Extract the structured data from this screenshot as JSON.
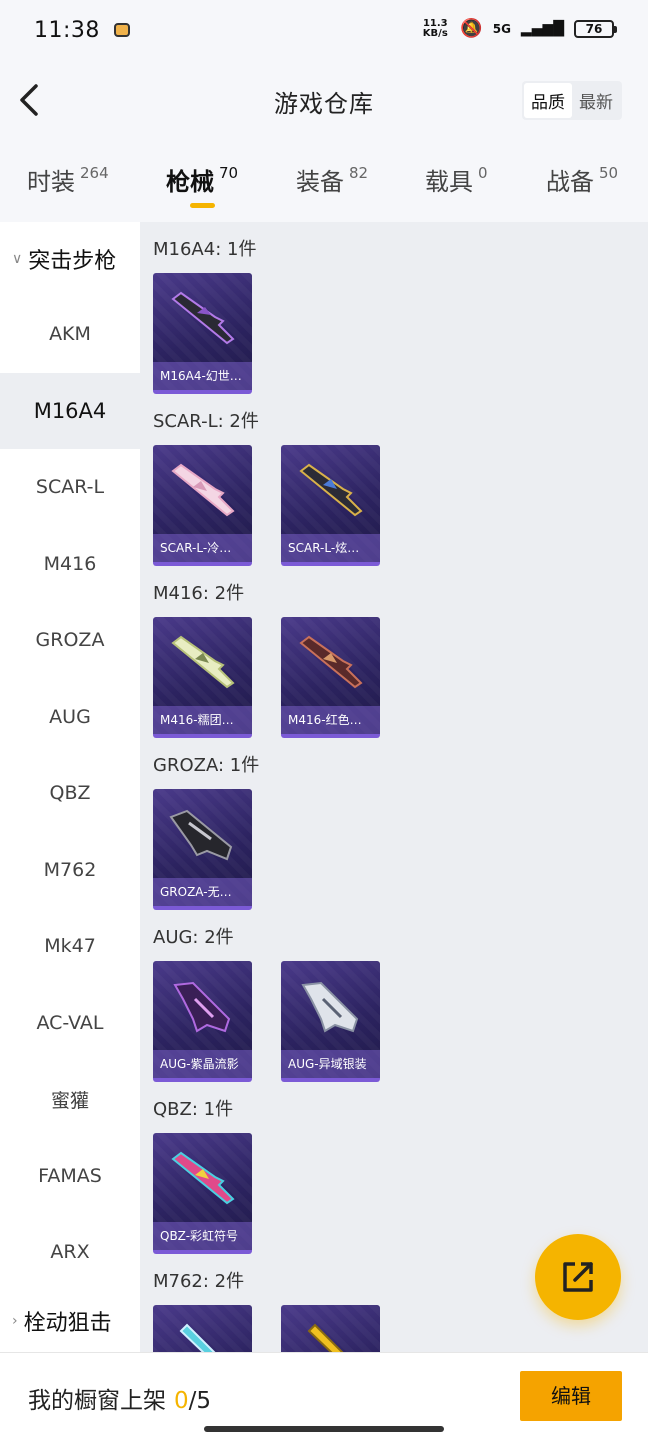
{
  "status_bar": {
    "time": "11:38",
    "speed": "11.3 KB/s",
    "signal": "5G",
    "battery": "76"
  },
  "header": {
    "title": "游戏仓库",
    "back_icon": "chevron-left-icon",
    "sort_options": [
      "品质",
      "最新"
    ],
    "sort_active": "品质"
  },
  "tabs": [
    {
      "label": "时装",
      "count": "264"
    },
    {
      "label": "枪械",
      "count": "70",
      "active": true
    },
    {
      "label": "装备",
      "count": "82"
    },
    {
      "label": "载具",
      "count": "0"
    },
    {
      "label": "战备",
      "count": "50"
    }
  ],
  "sidebar": {
    "category": "突击步枪",
    "items": [
      "AKM",
      "M16A4",
      "SCAR-L",
      "M416",
      "GROZA",
      "AUG",
      "QBZ",
      "M762",
      "Mk47",
      "AC-VAL",
      "蜜獾",
      "FAMAS",
      "ARX"
    ],
    "active": "M16A4",
    "next_category": "栓动狙击"
  },
  "groups": [
    {
      "title": "M16A4: 1件",
      "items": [
        {
          "name": "M16A4-幻世…"
        }
      ]
    },
    {
      "title": "SCAR-L: 2件",
      "items": [
        {
          "name": "SCAR-L-冷…"
        },
        {
          "name": "SCAR-L-炫…"
        }
      ]
    },
    {
      "title": "M416: 2件",
      "items": [
        {
          "name": "M416-糯团…"
        },
        {
          "name": "M416-红色…"
        }
      ]
    },
    {
      "title": "GROZA: 1件",
      "items": [
        {
          "name": "GROZA-无…"
        }
      ]
    },
    {
      "title": "AUG: 2件",
      "items": [
        {
          "name": "AUG-紫晶流影"
        },
        {
          "name": "AUG-异域银装"
        }
      ]
    },
    {
      "title": "QBZ: 1件",
      "items": [
        {
          "name": "QBZ-彩虹符号"
        }
      ]
    },
    {
      "title": "M762: 2件",
      "items": [
        {
          "name": ""
        },
        {
          "name": ""
        }
      ]
    }
  ],
  "bottom": {
    "shelf_label": "我的橱窗上架",
    "shelf_current": "0",
    "shelf_total": "/5",
    "edit_label": "编辑"
  },
  "colors": {
    "accent": "#f5b400",
    "card_bg": "#2c2360",
    "card_border": "#7b5ad6"
  }
}
